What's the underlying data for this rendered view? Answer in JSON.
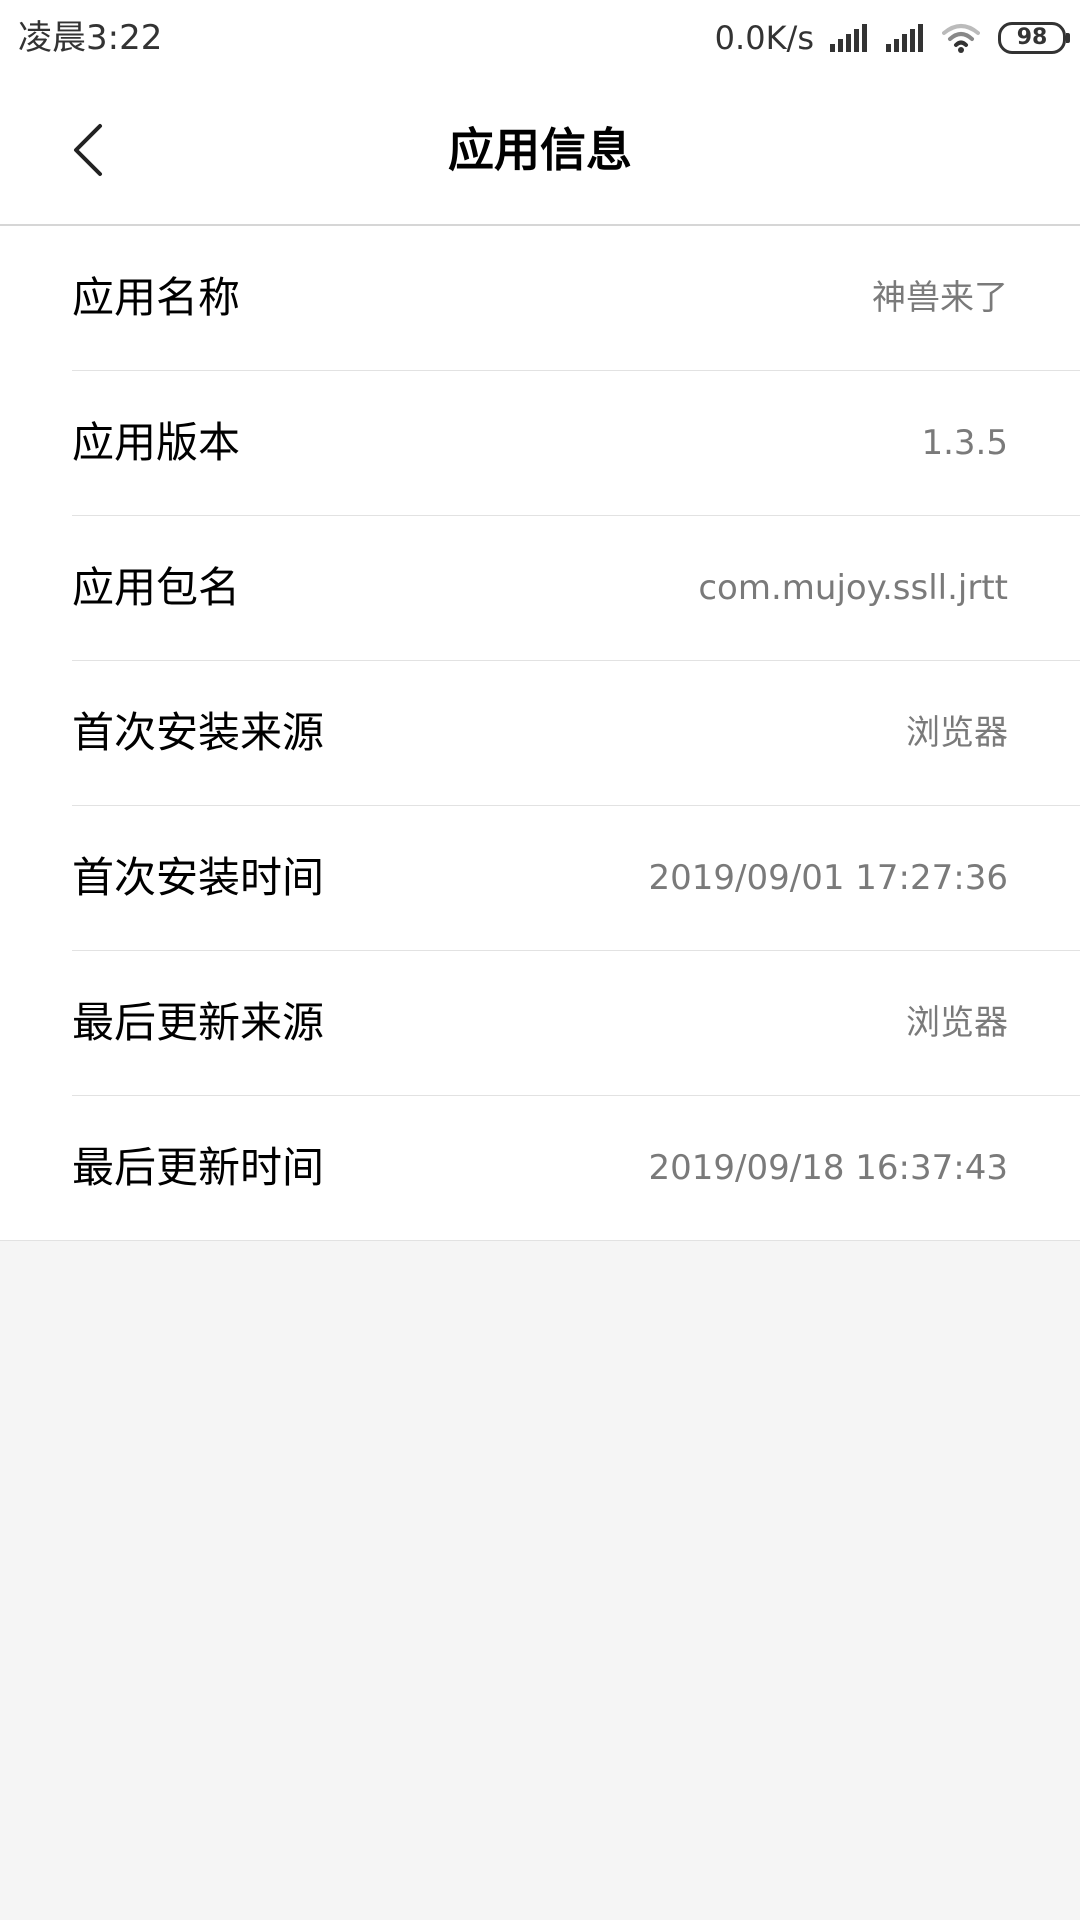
{
  "status_bar": {
    "time": "凌晨3:22",
    "net_speed": "0.0K/s",
    "battery": "98"
  },
  "header": {
    "title": "应用信息"
  },
  "info_rows": [
    {
      "label": "应用名称",
      "value": "神兽来了"
    },
    {
      "label": "应用版本",
      "value": "1.3.5"
    },
    {
      "label": "应用包名",
      "value": "com.mujoy.ssll.jrtt"
    },
    {
      "label": "首次安装来源",
      "value": "浏览器"
    },
    {
      "label": "首次安装时间",
      "value": "2019/09/01 17:27:36"
    },
    {
      "label": "最后更新来源",
      "value": "浏览器"
    },
    {
      "label": "最后更新时间",
      "value": "2019/09/18 16:37:43"
    }
  ]
}
